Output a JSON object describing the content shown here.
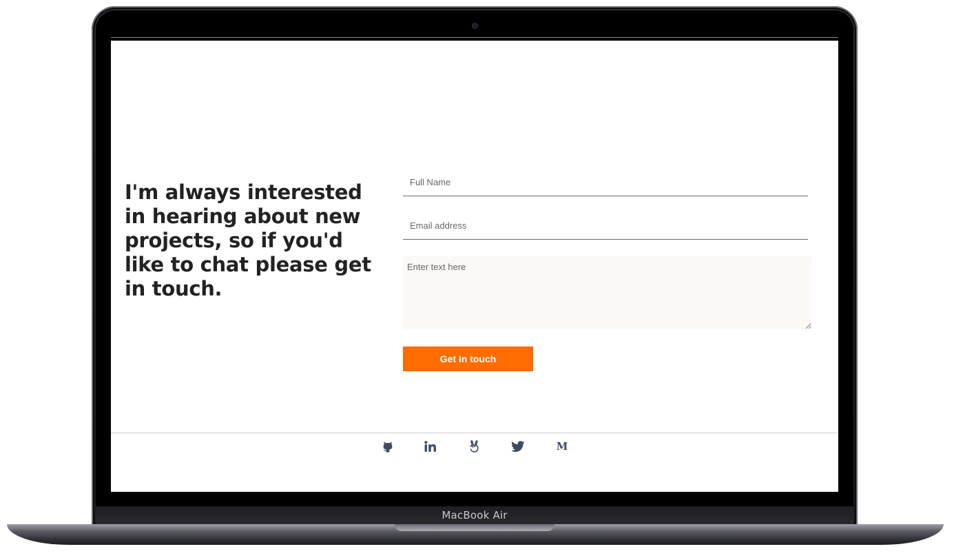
{
  "device": {
    "label": "MacBook Air"
  },
  "contact": {
    "headline": "I'm always interested in hearing about new projects, so if you'd like to chat please get in touch.",
    "full_name_placeholder": "Full Name",
    "email_placeholder": "Email address",
    "message_placeholder": "Enter text here",
    "submit_label": "Get In touch"
  },
  "colors": {
    "accent": "#ff6c00",
    "icon": "#3f4a63",
    "textarea_bg": "#fbf8f6"
  },
  "social": {
    "links": [
      {
        "icon": "github-icon"
      },
      {
        "icon": "linkedin-icon"
      },
      {
        "icon": "angellist-icon"
      },
      {
        "icon": "twitter-icon"
      },
      {
        "icon": "medium-icon",
        "glyph": "M"
      }
    ]
  }
}
